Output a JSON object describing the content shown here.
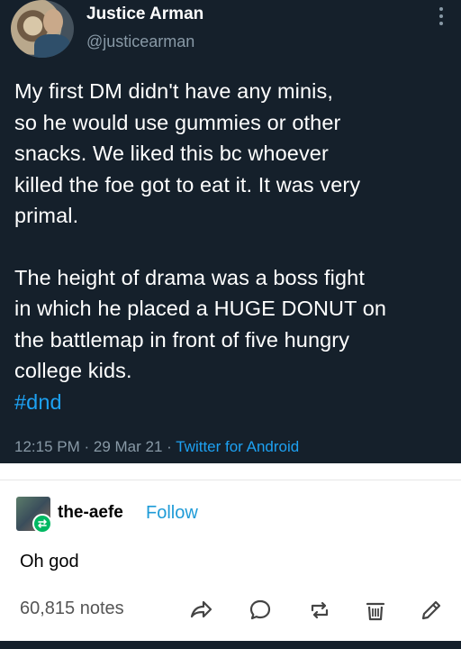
{
  "tweet": {
    "name": "Justice Arman",
    "handle": "@justicearman",
    "paragraph1": "My first DM didn't have any minis,\nso he would use gummies or other\nsnacks. We liked this bc whoever\nkilled the foe got to eat it. It was very\nprimal.",
    "paragraph2": "The height of drama was a boss fight\nin which he placed a HUGE DONUT on\nthe battlemap in front of five hungry\ncollege kids.",
    "hashtag": "#dnd",
    "timestamp": "12:15 PM · 29 Mar 21 · ",
    "source": "Twitter for Android"
  },
  "post": {
    "reblog_user": "the-aefe",
    "follow_label": "Follow",
    "comment": "Oh god",
    "notes": "60,815 notes"
  },
  "icons": {
    "more": "more-vertical-icon",
    "share": "share-icon",
    "reply": "reply-icon",
    "reblog": "reblog-icon",
    "delete": "delete-icon",
    "edit": "edit-icon"
  },
  "colors": {
    "tweet_bg": "#15202b",
    "link": "#1da1f2",
    "follow": "#1e9bd7",
    "reblog_badge": "#00b862"
  }
}
